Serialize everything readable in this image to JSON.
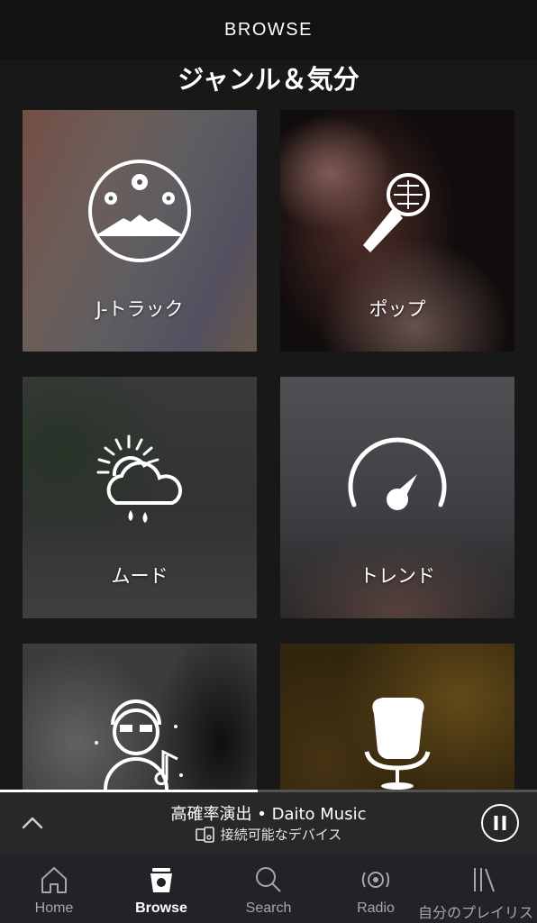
{
  "header": {
    "title": "BROWSE"
  },
  "section": {
    "title": "ジャンル＆気分"
  },
  "tiles": [
    {
      "label": "J-トラック",
      "icon": "mount-fuji-flowers-icon"
    },
    {
      "label": "ポップ",
      "icon": "microphone-icon"
    },
    {
      "label": "ムード",
      "icon": "sun-cloud-rain-icon"
    },
    {
      "label": "トレンド",
      "icon": "speedometer-icon"
    },
    {
      "label": "",
      "icon": "dj-headphones-icon"
    },
    {
      "label": "",
      "icon": "egg-chair-icon"
    }
  ],
  "player": {
    "track_title": "高確率演出",
    "separator": " • ",
    "artist": "Daito Music",
    "device_text": "接続可能なデバイス",
    "progress": 0.48
  },
  "tabs": [
    {
      "label": "Home",
      "icon": "home-icon",
      "active": false
    },
    {
      "label": "Browse",
      "icon": "browse-icon",
      "active": true
    },
    {
      "label": "Search",
      "icon": "search-icon",
      "active": false
    },
    {
      "label": "Radio",
      "icon": "radio-icon",
      "active": false
    },
    {
      "label": "自分のプレイリスト",
      "icon": "library-icon",
      "active": false
    }
  ]
}
